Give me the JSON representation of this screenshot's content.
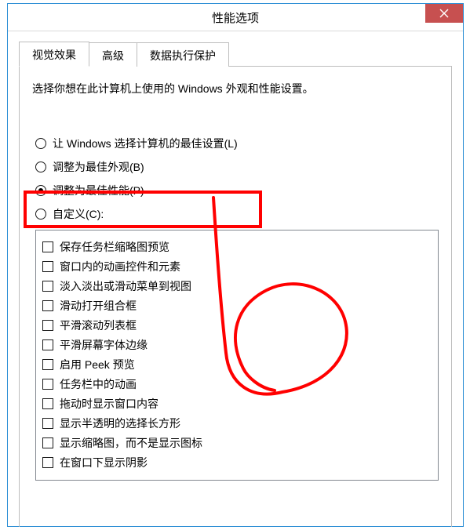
{
  "window": {
    "title": "性能选项"
  },
  "tabs": [
    {
      "label": "视觉效果",
      "active": true
    },
    {
      "label": "高级",
      "active": false
    },
    {
      "label": "数据执行保护",
      "active": false
    }
  ],
  "description": "选择你想在此计算机上使用的 Windows 外观和性能设置。",
  "radios": [
    {
      "label": "让 Windows 选择计算机的最佳设置(L)",
      "checked": false
    },
    {
      "label": "调整为最佳外观(B)",
      "checked": false
    },
    {
      "label": "调整为最佳性能(P)",
      "checked": true
    },
    {
      "label": "自定义(C):",
      "checked": false
    }
  ],
  "checkboxes": [
    {
      "label": "保存任务栏缩略图预览",
      "checked": false
    },
    {
      "label": "窗口内的动画控件和元素",
      "checked": false
    },
    {
      "label": "淡入淡出或滑动菜单到视图",
      "checked": false
    },
    {
      "label": "滑动打开组合框",
      "checked": false
    },
    {
      "label": "平滑滚动列表框",
      "checked": false
    },
    {
      "label": "平滑屏幕字体边缘",
      "checked": false
    },
    {
      "label": "启用 Peek 预览",
      "checked": false
    },
    {
      "label": "任务栏中的动画",
      "checked": false
    },
    {
      "label": "拖动时显示窗口内容",
      "checked": false
    },
    {
      "label": "显示半透明的选择长方形",
      "checked": false
    },
    {
      "label": "显示缩略图，而不是显示图标",
      "checked": false
    },
    {
      "label": "在窗口下显示阴影",
      "checked": false
    }
  ],
  "annotation": {
    "color": "#ff0000"
  }
}
